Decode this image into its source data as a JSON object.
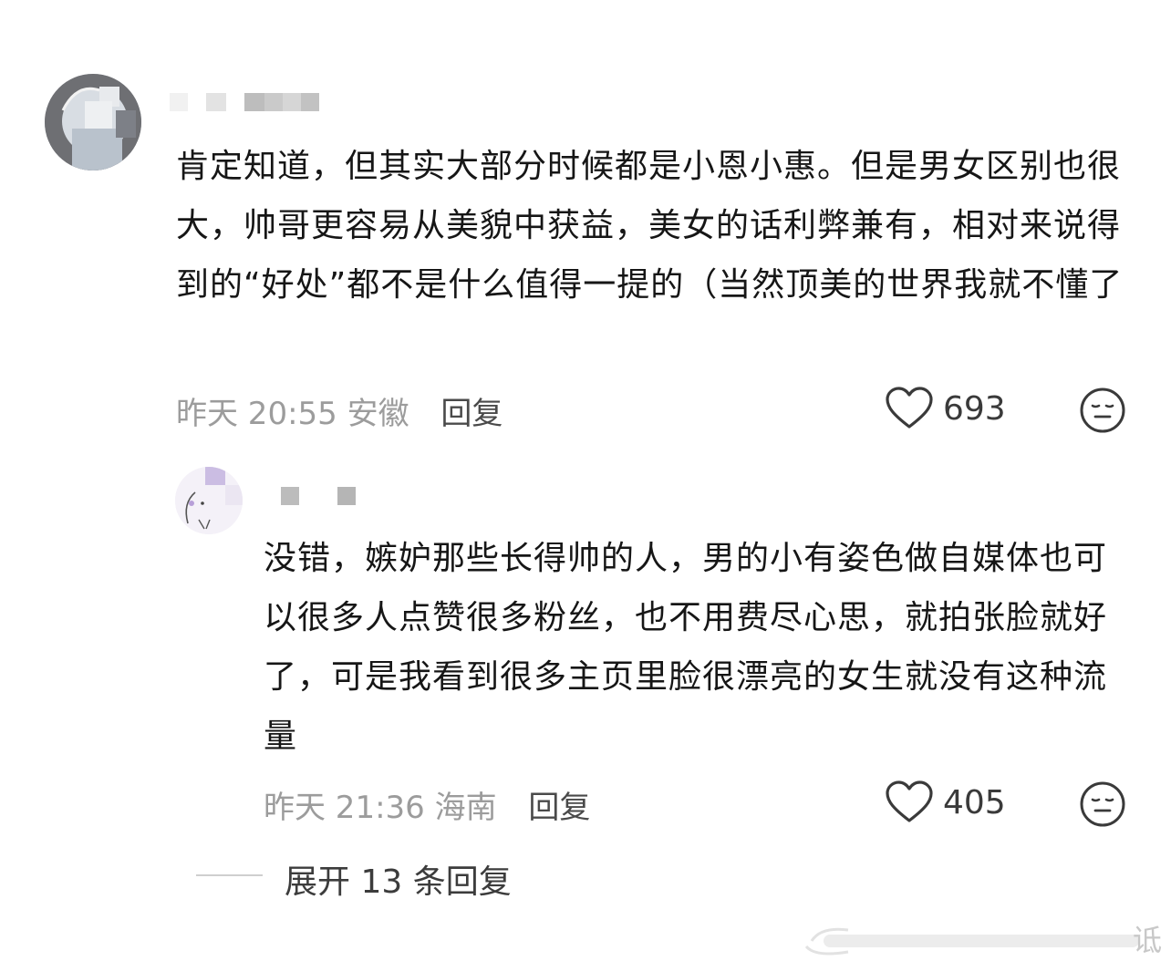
{
  "comments": [
    {
      "text": "肯定知道，但其实大部分时候都是小恩小惠。但是男女区别也很大，帅哥更容易从美貌中获益，美女的话利弊兼有，相对来说得到的“好处”都不是什么值得一提的（当然顶美的世界我就不懂了",
      "time": "昨天 20:55",
      "location": "安徽",
      "reply_label": "回复",
      "likes": "693"
    },
    {
      "text": "没错，嫉妒那些长得帅的人，男的小有姿色做自媒体也可以很多人点赞很多粉丝，也不用费尽心思，就拍张脸就好了，可是我看到很多主页里脸很漂亮的女生就没有这种流量",
      "time": "昨天 21:36",
      "location": "海南",
      "reply_label": "回复",
      "likes": "405"
    }
  ],
  "expand_label": "展开 13 条回复",
  "watermark_char": "诋",
  "icons": {
    "like": "heart-outline-icon",
    "reaction": "neutral-face-icon"
  },
  "colors": {
    "text": "#161616",
    "meta": "#9c9c9c",
    "reply": "#4a4a4a"
  }
}
